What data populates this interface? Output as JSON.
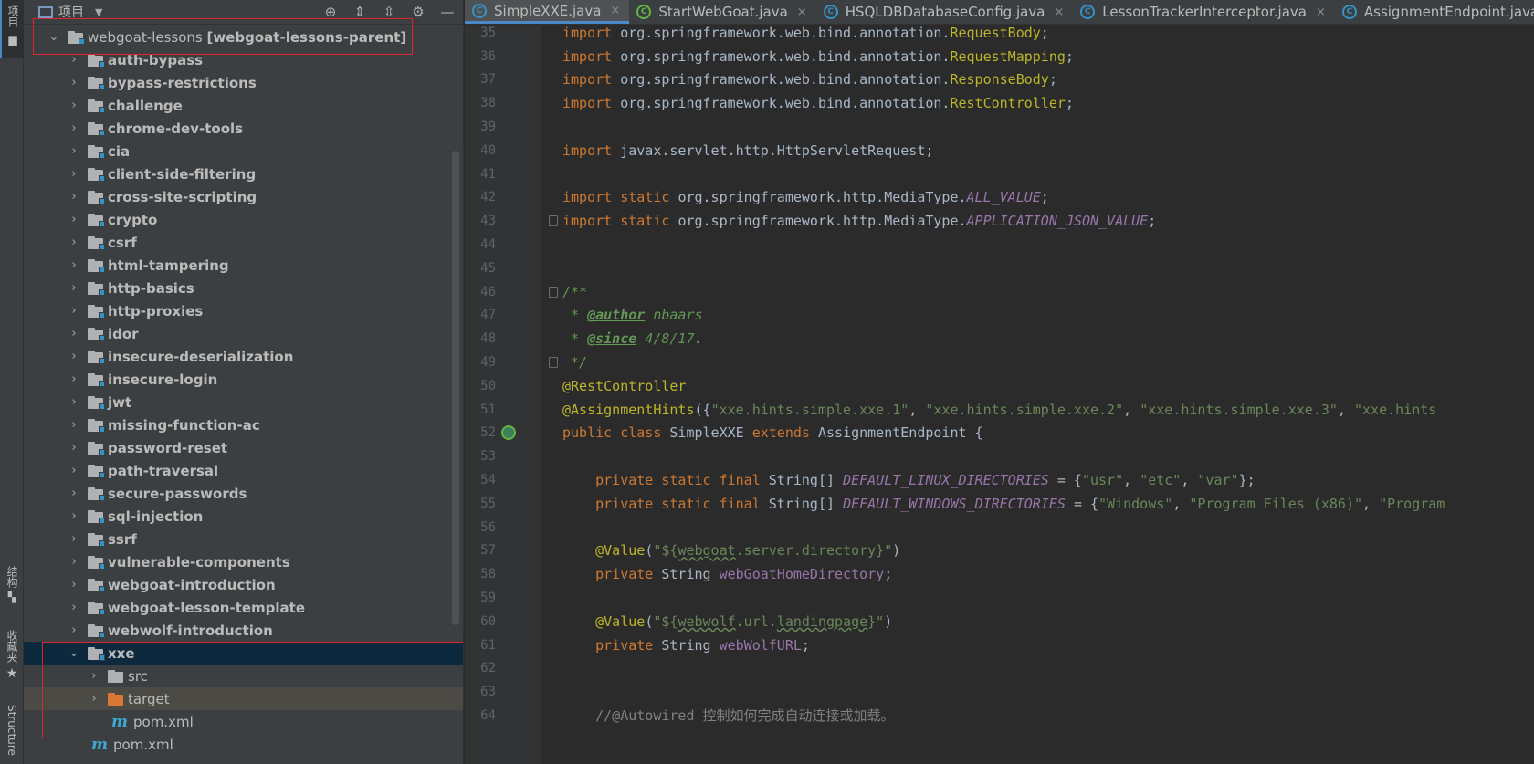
{
  "left_strip": {
    "project_tab": "项目",
    "structure_cn_tab": "结构",
    "favorites_tab": "收藏夹",
    "structure_tab": "Structure"
  },
  "project_panel": {
    "title": "项目",
    "tree": {
      "root": {
        "name": "webgoat-lessons",
        "suffix": "[webgoat-lessons-parent]"
      },
      "modules": [
        "auth-bypass",
        "bypass-restrictions",
        "challenge",
        "chrome-dev-tools",
        "cia",
        "client-side-filtering",
        "cross-site-scripting",
        "crypto",
        "csrf",
        "html-tampering",
        "http-basics",
        "http-proxies",
        "idor",
        "insecure-deserialization",
        "insecure-login",
        "jwt",
        "missing-function-ac",
        "password-reset",
        "path-traversal",
        "secure-passwords",
        "sql-injection",
        "ssrf",
        "vulnerable-components",
        "webgoat-introduction",
        "webgoat-lesson-template",
        "webwolf-introduction"
      ],
      "expanded_module": "xxe",
      "xxe_children": [
        "src",
        "target",
        "pom.xml"
      ],
      "root_pom": "pom.xml"
    }
  },
  "tabs": [
    {
      "label": "SimpleXXE.java",
      "icon": "class-icon"
    },
    {
      "label": "StartWebGoat.java",
      "icon": "run-class-icon"
    },
    {
      "label": "HSQLDBDatabaseConfig.java",
      "icon": "class-icon"
    },
    {
      "label": "LessonTrackerInterceptor.java",
      "icon": "class-icon"
    },
    {
      "label": "AssignmentEndpoint.java",
      "icon": "class-icon"
    }
  ],
  "editor": {
    "line_numbers": [
      "35",
      "36",
      "37",
      "38",
      "39",
      "40",
      "41",
      "42",
      "43",
      "44",
      "45",
      "46",
      "47",
      "48",
      "49",
      "50",
      "51",
      "52",
      "53",
      "54",
      "55",
      "56",
      "57",
      "58",
      "59",
      "60",
      "61",
      "62",
      "63",
      "64"
    ]
  }
}
